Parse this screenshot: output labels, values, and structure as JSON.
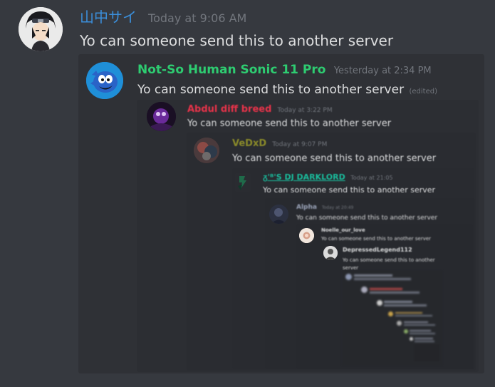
{
  "messages": [
    {
      "username": "山中サイ",
      "timestamp": "Today at 9:06 AM",
      "text": "Yo can someone send this to another server",
      "name_color": "#3b8fdb"
    },
    {
      "username": "Not-So Human Sonic 11 Pro",
      "timestamp": "Yesterday at 2:34 PM",
      "text": "Yo can someone send this to another server",
      "edited": "(edited)",
      "name_color": "#2ecc71"
    },
    {
      "username": "Abdul diff breed",
      "timestamp": "Today at 3:22 PM",
      "text": "Yo can someone send this to another server",
      "name_color": "#e8334a"
    },
    {
      "username": "VeDxD",
      "timestamp": "Today at 9:07 PM",
      "text": "Yo can someone send this to another server",
      "name_color": "#8a8a2a"
    },
    {
      "username": "ᵹ'ᴮ'S DJ DARKLORD",
      "timestamp": "Today at 21:05",
      "text": "Yo can someone send this to another server",
      "name_color": "#1abc9c"
    },
    {
      "username": "Alpha",
      "timestamp": "Today at 20:49",
      "text": "Yo can someone send this to another server",
      "name_color": "#9aa3b8"
    },
    {
      "username": "Noelle_our_love",
      "timestamp": "",
      "text": "Yo can someone send this to another server",
      "name_color": "#dcddde"
    },
    {
      "username": "DepressedLegend112",
      "timestamp": "",
      "text": "Yo can someone send this to another server",
      "name_color": "#dcddde"
    }
  ],
  "colors": {
    "background": "#36393f",
    "embed_bg_1": "#2f3136",
    "embed_bg_2": "#2b2d31",
    "embed_bg_3": "#292b2f",
    "text": "#dcddde",
    "muted": "#72767d"
  }
}
